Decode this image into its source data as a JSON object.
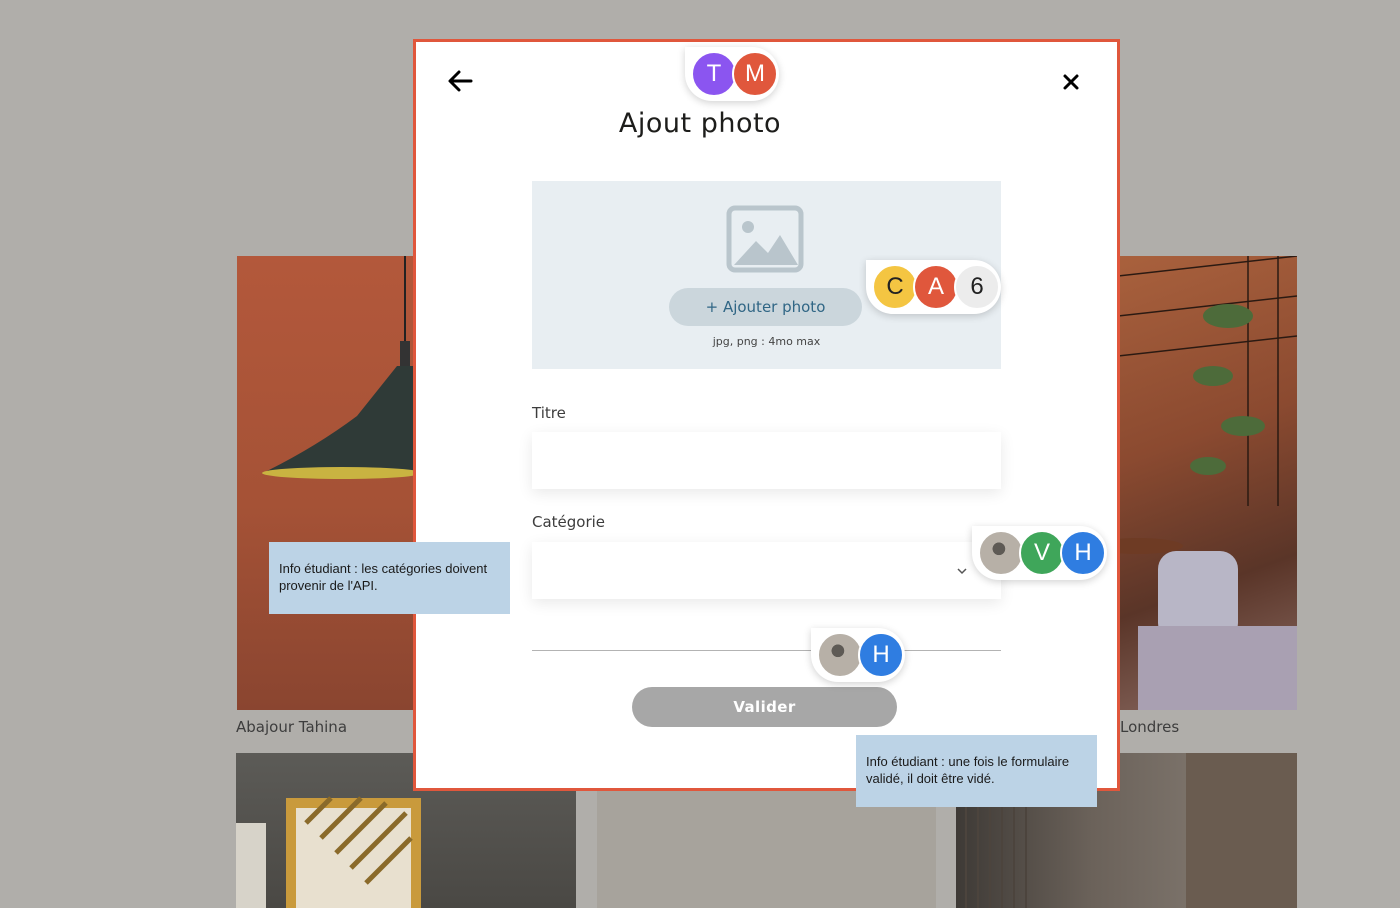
{
  "gallery": {
    "captions": [
      "Abajour Tahina",
      "Londres"
    ]
  },
  "modal": {
    "title": "Ajout photo",
    "upload_button": "+ Ajouter photo",
    "upload_hint": "jpg, png : 4mo max",
    "title_label": "Titre",
    "category_label": "Catégorie",
    "submit_label": "Valider",
    "border_color": "#e0573c"
  },
  "notes": [
    "Info étudiant : les catégories doivent provenir de l'API.",
    "Info étudiant : une fois le formulaire validé, il doit être vidé."
  ],
  "presence": {
    "group1": [
      {
        "initial": "T",
        "color": "#8b55f0"
      },
      {
        "initial": "M",
        "color": "#e0573c"
      }
    ],
    "group2": [
      {
        "initial": "C",
        "color": "#f4c542"
      },
      {
        "initial": "A",
        "color": "#e0573c"
      },
      {
        "initial": "6",
        "color": "#ececec"
      }
    ],
    "group3": [
      {
        "initial": "",
        "color": "photo"
      },
      {
        "initial": "V",
        "color": "#3fa65a"
      },
      {
        "initial": "H",
        "color": "#2f7de1"
      }
    ],
    "group4": [
      {
        "initial": "",
        "color": "photo"
      },
      {
        "initial": "H",
        "color": "#2f7de1"
      }
    ]
  }
}
